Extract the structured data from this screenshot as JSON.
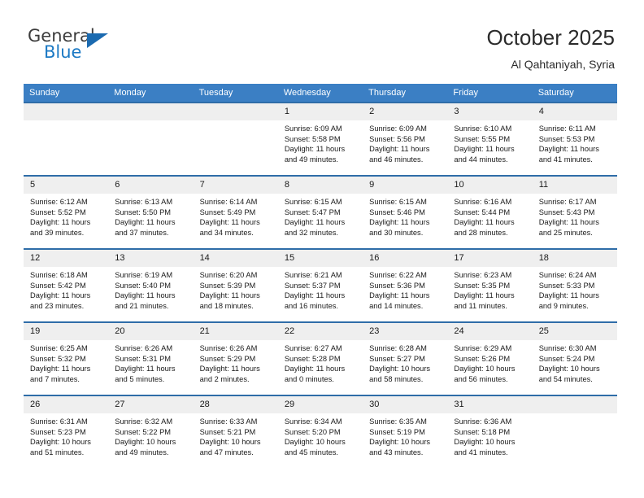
{
  "brand": {
    "name_top": "General",
    "name_bottom": "Blue",
    "accent_color": "#1b79c4",
    "triangle_color": "#1b6ab0"
  },
  "header": {
    "title": "October 2025",
    "subtitle": "Al Qahtaniyah, Syria"
  },
  "calendar": {
    "header_bg": "#3b7fc4",
    "row_border_color": "#2f6da8",
    "daynum_bg": "#efefef",
    "weekdays": [
      "Sunday",
      "Monday",
      "Tuesday",
      "Wednesday",
      "Thursday",
      "Friday",
      "Saturday"
    ],
    "weeks": [
      [
        {
          "day": "",
          "lines": []
        },
        {
          "day": "",
          "lines": []
        },
        {
          "day": "",
          "lines": []
        },
        {
          "day": "1",
          "lines": [
            "Sunrise: 6:09 AM",
            "Sunset: 5:58 PM",
            "Daylight: 11 hours",
            "and 49 minutes."
          ]
        },
        {
          "day": "2",
          "lines": [
            "Sunrise: 6:09 AM",
            "Sunset: 5:56 PM",
            "Daylight: 11 hours",
            "and 46 minutes."
          ]
        },
        {
          "day": "3",
          "lines": [
            "Sunrise: 6:10 AM",
            "Sunset: 5:55 PM",
            "Daylight: 11 hours",
            "and 44 minutes."
          ]
        },
        {
          "day": "4",
          "lines": [
            "Sunrise: 6:11 AM",
            "Sunset: 5:53 PM",
            "Daylight: 11 hours",
            "and 41 minutes."
          ]
        }
      ],
      [
        {
          "day": "5",
          "lines": [
            "Sunrise: 6:12 AM",
            "Sunset: 5:52 PM",
            "Daylight: 11 hours",
            "and 39 minutes."
          ]
        },
        {
          "day": "6",
          "lines": [
            "Sunrise: 6:13 AM",
            "Sunset: 5:50 PM",
            "Daylight: 11 hours",
            "and 37 minutes."
          ]
        },
        {
          "day": "7",
          "lines": [
            "Sunrise: 6:14 AM",
            "Sunset: 5:49 PM",
            "Daylight: 11 hours",
            "and 34 minutes."
          ]
        },
        {
          "day": "8",
          "lines": [
            "Sunrise: 6:15 AM",
            "Sunset: 5:47 PM",
            "Daylight: 11 hours",
            "and 32 minutes."
          ]
        },
        {
          "day": "9",
          "lines": [
            "Sunrise: 6:15 AM",
            "Sunset: 5:46 PM",
            "Daylight: 11 hours",
            "and 30 minutes."
          ]
        },
        {
          "day": "10",
          "lines": [
            "Sunrise: 6:16 AM",
            "Sunset: 5:44 PM",
            "Daylight: 11 hours",
            "and 28 minutes."
          ]
        },
        {
          "day": "11",
          "lines": [
            "Sunrise: 6:17 AM",
            "Sunset: 5:43 PM",
            "Daylight: 11 hours",
            "and 25 minutes."
          ]
        }
      ],
      [
        {
          "day": "12",
          "lines": [
            "Sunrise: 6:18 AM",
            "Sunset: 5:42 PM",
            "Daylight: 11 hours",
            "and 23 minutes."
          ]
        },
        {
          "day": "13",
          "lines": [
            "Sunrise: 6:19 AM",
            "Sunset: 5:40 PM",
            "Daylight: 11 hours",
            "and 21 minutes."
          ]
        },
        {
          "day": "14",
          "lines": [
            "Sunrise: 6:20 AM",
            "Sunset: 5:39 PM",
            "Daylight: 11 hours",
            "and 18 minutes."
          ]
        },
        {
          "day": "15",
          "lines": [
            "Sunrise: 6:21 AM",
            "Sunset: 5:37 PM",
            "Daylight: 11 hours",
            "and 16 minutes."
          ]
        },
        {
          "day": "16",
          "lines": [
            "Sunrise: 6:22 AM",
            "Sunset: 5:36 PM",
            "Daylight: 11 hours",
            "and 14 minutes."
          ]
        },
        {
          "day": "17",
          "lines": [
            "Sunrise: 6:23 AM",
            "Sunset: 5:35 PM",
            "Daylight: 11 hours",
            "and 11 minutes."
          ]
        },
        {
          "day": "18",
          "lines": [
            "Sunrise: 6:24 AM",
            "Sunset: 5:33 PM",
            "Daylight: 11 hours",
            "and 9 minutes."
          ]
        }
      ],
      [
        {
          "day": "19",
          "lines": [
            "Sunrise: 6:25 AM",
            "Sunset: 5:32 PM",
            "Daylight: 11 hours",
            "and 7 minutes."
          ]
        },
        {
          "day": "20",
          "lines": [
            "Sunrise: 6:26 AM",
            "Sunset: 5:31 PM",
            "Daylight: 11 hours",
            "and 5 minutes."
          ]
        },
        {
          "day": "21",
          "lines": [
            "Sunrise: 6:26 AM",
            "Sunset: 5:29 PM",
            "Daylight: 11 hours",
            "and 2 minutes."
          ]
        },
        {
          "day": "22",
          "lines": [
            "Sunrise: 6:27 AM",
            "Sunset: 5:28 PM",
            "Daylight: 11 hours",
            "and 0 minutes."
          ]
        },
        {
          "day": "23",
          "lines": [
            "Sunrise: 6:28 AM",
            "Sunset: 5:27 PM",
            "Daylight: 10 hours",
            "and 58 minutes."
          ]
        },
        {
          "day": "24",
          "lines": [
            "Sunrise: 6:29 AM",
            "Sunset: 5:26 PM",
            "Daylight: 10 hours",
            "and 56 minutes."
          ]
        },
        {
          "day": "25",
          "lines": [
            "Sunrise: 6:30 AM",
            "Sunset: 5:24 PM",
            "Daylight: 10 hours",
            "and 54 minutes."
          ]
        }
      ],
      [
        {
          "day": "26",
          "lines": [
            "Sunrise: 6:31 AM",
            "Sunset: 5:23 PM",
            "Daylight: 10 hours",
            "and 51 minutes."
          ]
        },
        {
          "day": "27",
          "lines": [
            "Sunrise: 6:32 AM",
            "Sunset: 5:22 PM",
            "Daylight: 10 hours",
            "and 49 minutes."
          ]
        },
        {
          "day": "28",
          "lines": [
            "Sunrise: 6:33 AM",
            "Sunset: 5:21 PM",
            "Daylight: 10 hours",
            "and 47 minutes."
          ]
        },
        {
          "day": "29",
          "lines": [
            "Sunrise: 6:34 AM",
            "Sunset: 5:20 PM",
            "Daylight: 10 hours",
            "and 45 minutes."
          ]
        },
        {
          "day": "30",
          "lines": [
            "Sunrise: 6:35 AM",
            "Sunset: 5:19 PM",
            "Daylight: 10 hours",
            "and 43 minutes."
          ]
        },
        {
          "day": "31",
          "lines": [
            "Sunrise: 6:36 AM",
            "Sunset: 5:18 PM",
            "Daylight: 10 hours",
            "and 41 minutes."
          ]
        },
        {
          "day": "",
          "lines": []
        }
      ]
    ]
  }
}
